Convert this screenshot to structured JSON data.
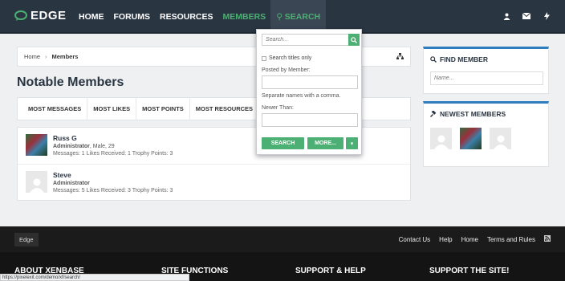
{
  "header": {
    "logo": "EDGE",
    "nav": [
      {
        "label": "HOME"
      },
      {
        "label": "FORUMS"
      },
      {
        "label": "RESOURCES"
      },
      {
        "label": "MEMBERS"
      },
      {
        "label": "SEARCH"
      }
    ],
    "icons": [
      "user-icon",
      "envelope-icon",
      "bolt-icon"
    ]
  },
  "breadcrumb": {
    "home": "Home",
    "current": "Members"
  },
  "page_title": "Notable Members",
  "tabs": [
    "MOST MESSAGES",
    "MOST LIKES",
    "MOST POINTS",
    "MOST RESOURCES"
  ],
  "members": [
    {
      "name": "Russ G",
      "role": "Administrator",
      "extra": ", Male, 29",
      "stats": "Messages: 1 Likes Received: 1 Trophy Points: 3"
    },
    {
      "name": "Steve",
      "role": "Administrator",
      "extra": "",
      "stats": "Messages: 5 Likes Received: 3 Trophy Points: 3"
    }
  ],
  "sidebar": {
    "find_title": "FIND MEMBER",
    "find_placeholder": "Name...",
    "newest_title": "NEWEST MEMBERS"
  },
  "search_dropdown": {
    "placeholder": "Search...",
    "titles_only": "Search titles only",
    "posted_by": "Posted by Member:",
    "hint": "Separate names with a comma.",
    "newer_than": "Newer Than:",
    "search_btn": "SEARCH",
    "more_btn": "MORE..."
  },
  "footer": {
    "edge": "Edge",
    "links": [
      "Contact Us",
      "Help",
      "Home",
      "Terms and Rules"
    ],
    "columns": [
      "ABOUT XENBASE",
      "SITE FUNCTIONS",
      "SUPPORT & HELP",
      "SUPPORT THE SITE!"
    ]
  },
  "status_url": "https://pixelexit.com/demo/xf/search/",
  "colors": {
    "header_bg": "#2a3542",
    "accent_green": "#4caf73",
    "accent_blue": "#2f7dbd"
  }
}
